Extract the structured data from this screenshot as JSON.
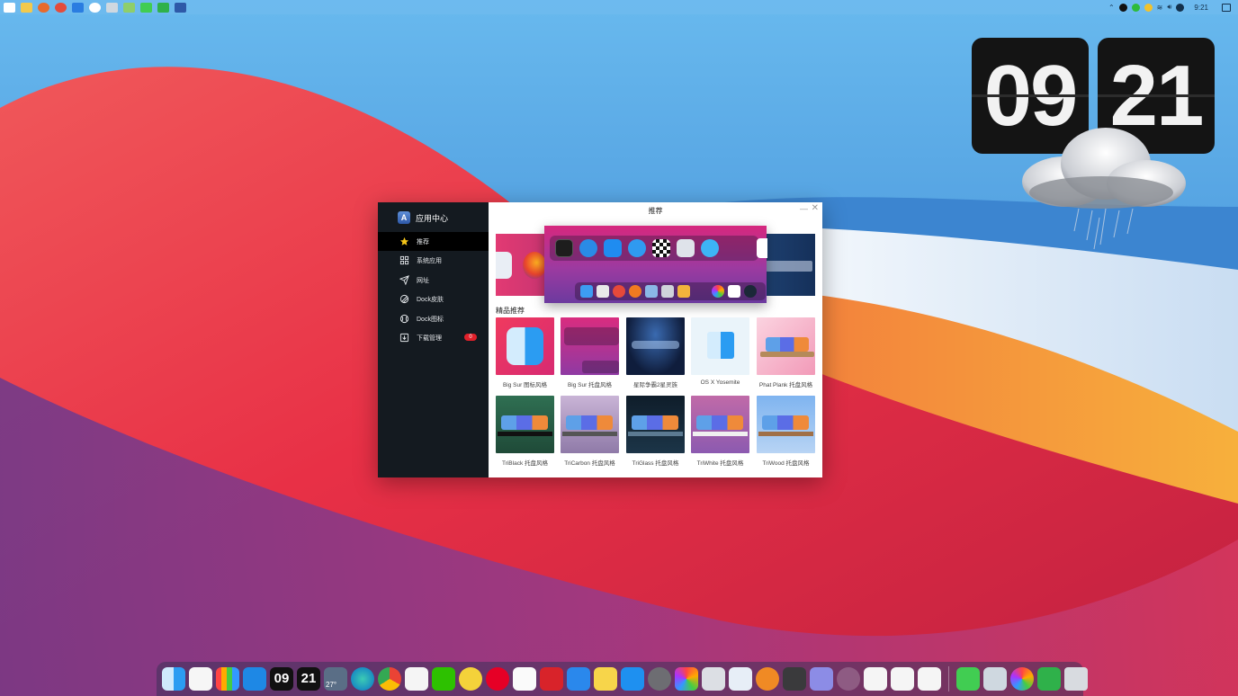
{
  "topbar": {
    "app_icons": [
      "windows-start-icon",
      "folder-icon",
      "firefox-icon",
      "chrome-icon",
      "blue-app-icon",
      "white-app-icon",
      "monitor-icon",
      "cat-icon",
      "qt-icon",
      "qt-green-icon",
      "launcher-icon"
    ],
    "tray_icons": [
      "chevron-up-icon",
      "qq-tray-icon",
      "wechat-tray-icon",
      "tray-yellow-icon",
      "wifi-icon",
      "volume-icon",
      "language-icon"
    ],
    "time": "9:21"
  },
  "clock_widget": {
    "hours": "09",
    "minutes": "21"
  },
  "window": {
    "sidebar": {
      "title": "应用中心",
      "logo": "A",
      "items": [
        {
          "label": "推荐",
          "icon": "star-icon",
          "active": true
        },
        {
          "label": "系统应用",
          "icon": "grid-icon"
        },
        {
          "label": "网址",
          "icon": "paper-plane-icon"
        },
        {
          "label": "Dock皮肤",
          "icon": "brush-icon"
        },
        {
          "label": "Dock图标",
          "icon": "ball-icon"
        },
        {
          "label": "下载管理",
          "icon": "download-icon",
          "badge": "0"
        }
      ]
    },
    "title": "推荐",
    "minimize": "—",
    "close": "✕",
    "section_title": "精品推荐",
    "cards": [
      {
        "caption": "Big Sur 图标风格"
      },
      {
        "caption": "Big Sur 托盘风格"
      },
      {
        "caption": "星际争霸2星灵族"
      },
      {
        "caption": "OS X Yosemite"
      },
      {
        "caption": "Phat Plank 托盘风格"
      },
      {
        "caption": "TriBlack 托盘风格"
      },
      {
        "caption": "TriCarbon 托盘风格"
      },
      {
        "caption": "TriGlass 托盘风格"
      },
      {
        "caption": "TriWhite 托盘风格"
      },
      {
        "caption": "TriWood 托盘风格"
      }
    ]
  },
  "dock": {
    "weather_temp": "27°",
    "clock_hours": "09",
    "clock_minutes": "21",
    "icons": [
      "finder-icon",
      "home-icon",
      "launchpad-icon",
      "windows-icon",
      "clock-hours-icon",
      "clock-minutes-icon",
      "weather-icon",
      "edge-icon",
      "chrome-icon",
      "qq-icon",
      "wechat-icon",
      "browser-icon",
      "netease-music-icon",
      "music-icon",
      "red-app-icon",
      "pen-app-icon",
      "notes-icon",
      "app-store-icon",
      "system-prefs-icon",
      "photos-icon",
      "screenshot-icon",
      "magnifier-icon",
      "orange-app-icon",
      "calculator-icon",
      "speaker-icon",
      "power-icon",
      "more-icon",
      "chevron-down-icon",
      "chevron-down-icon-2",
      "qt-creator-icon",
      "files-icon",
      "color-wheel-icon",
      "qt-icon",
      "trash-icon"
    ]
  }
}
